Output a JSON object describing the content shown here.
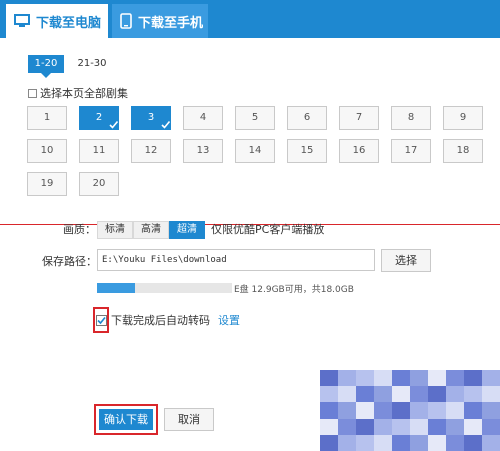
{
  "tabs": [
    {
      "label": "下载至电脑",
      "icon": "monitor-icon",
      "active": true
    },
    {
      "label": "下载至手机",
      "icon": "phone-icon",
      "active": false
    }
  ],
  "range_tabs": [
    "1-20",
    "21-30"
  ],
  "select_all_label": "选择本页全部剧集",
  "episodes": [
    "1",
    "2",
    "3",
    "4",
    "5",
    "6",
    "7",
    "8",
    "9",
    "10",
    "11",
    "12",
    "13",
    "14",
    "15",
    "16",
    "17",
    "18",
    "19",
    "20"
  ],
  "selected_episodes": [
    "2",
    "3"
  ],
  "quality": {
    "label": "画质：",
    "options": [
      "标清",
      "高清",
      "超清"
    ],
    "selected": "超清",
    "note": "仅限优酷PC客户端播放"
  },
  "save_path": {
    "label": "保存路径：",
    "value": "E:\\Youku Files\\download",
    "browse_label": "选择"
  },
  "disk": {
    "info": "E盘 12.9GB可用，共18.0GB",
    "used_fraction": 0.28
  },
  "auto_convert": {
    "checked": true,
    "label": "下载完成后自动转码",
    "settings_link": "设置"
  },
  "footer": {
    "confirm_label": "确认下载",
    "cancel_label": "取消"
  },
  "colors": {
    "accent": "#1e88d0",
    "highlight": "#d9262b"
  }
}
